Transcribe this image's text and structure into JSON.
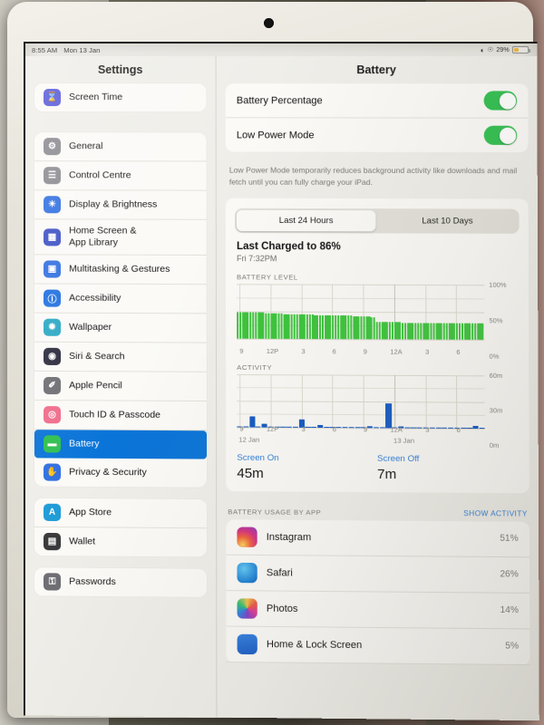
{
  "statusbar": {
    "time": "8:55 AM",
    "date": "Mon 13 Jan",
    "wifi_icon": "wifi-icon",
    "rotation_lock_icon": "rotation-lock-icon",
    "battery_percent": "29%",
    "battery_level": 29
  },
  "sidebar": {
    "title": "Settings",
    "groups": [
      {
        "items": [
          {
            "label": "Screen Time",
            "icon": "hourglass-icon",
            "color": "#5757d6",
            "selected": false
          }
        ]
      },
      {
        "items": [
          {
            "label": "General",
            "icon": "gear-icon",
            "color": "#8a8a8f",
            "selected": false
          },
          {
            "label": "Control Centre",
            "icon": "sliders-icon",
            "color": "#8a8a8f",
            "selected": false
          },
          {
            "label": "Display & Brightness",
            "icon": "brightness-icon",
            "color": "#2f6fe0",
            "selected": false
          },
          {
            "label": "Home Screen &\nApp Library",
            "icon": "app-grid-icon",
            "color": "#3b4fc4",
            "selected": false
          },
          {
            "label": "Multitasking & Gestures",
            "icon": "multitasking-icon",
            "color": "#2f6fe0",
            "selected": false
          },
          {
            "label": "Accessibility",
            "icon": "accessibility-icon",
            "color": "#1f6fe0",
            "selected": false
          },
          {
            "label": "Wallpaper",
            "icon": "wallpaper-icon",
            "color": "#2aa8c4",
            "selected": false
          },
          {
            "label": "Siri & Search",
            "icon": "siri-icon",
            "color": "#2b2b3d",
            "selected": false
          },
          {
            "label": "Apple Pencil",
            "icon": "pencil-icon",
            "color": "#6e6e73",
            "selected": false
          },
          {
            "label": "Touch ID & Passcode",
            "icon": "fingerprint-icon",
            "color": "#f06c8a",
            "selected": false
          },
          {
            "label": "Battery",
            "icon": "battery-icon",
            "color": "#2fbf4f",
            "selected": true
          },
          {
            "label": "Privacy & Security",
            "icon": "hand-icon",
            "color": "#2f6fe0",
            "selected": false
          }
        ]
      },
      {
        "items": [
          {
            "label": "App Store",
            "icon": "app-store-icon",
            "color": "#1e9bd7",
            "selected": false
          },
          {
            "label": "Wallet",
            "icon": "wallet-icon",
            "color": "#3a3a3c",
            "selected": false
          }
        ]
      },
      {
        "items": [
          {
            "label": "Passwords",
            "icon": "key-icon",
            "color": "#6e6e73",
            "selected": false
          }
        ]
      }
    ]
  },
  "detail": {
    "title": "Battery",
    "toggles": [
      {
        "label": "Battery Percentage",
        "on": true
      },
      {
        "label": "Low Power Mode",
        "on": true
      }
    ],
    "footnote": "Low Power Mode temporarily reduces background activity like downloads and mail fetch until you can fully charge your iPad.",
    "segmented": {
      "options": [
        "Last 24 Hours",
        "Last 10 Days"
      ],
      "selected_index": 0
    },
    "last_charged": {
      "title": "Last Charged to 86%",
      "subtitle": "Fri 7:32PM"
    },
    "battery_section_label": "BATTERY LEVEL",
    "activity_section_label": "ACTIVITY",
    "stats": [
      {
        "key": "Screen On",
        "value": "45m"
      },
      {
        "key": "Screen Off",
        "value": "7m"
      }
    ],
    "usage_header": {
      "left": "BATTERY USAGE BY APP",
      "right": "SHOW ACTIVITY"
    },
    "apps": [
      {
        "name": "Instagram",
        "percent": "51%",
        "icon": "instagram-icon"
      },
      {
        "name": "Safari",
        "percent": "26%",
        "icon": "safari-icon"
      },
      {
        "name": "Photos",
        "percent": "14%",
        "icon": "photos-icon"
      },
      {
        "name": "Home & Lock Screen",
        "percent": "5%",
        "icon": "home-lock-screen-icon"
      }
    ]
  },
  "chart_data": [
    {
      "type": "bar",
      "title": "BATTERY LEVEL",
      "ylabel": "",
      "xlabel": "",
      "ylim": [
        0,
        100
      ],
      "ytick_labels": [
        "100%",
        "50%",
        "0%"
      ],
      "ytick_values": [
        100,
        50,
        0
      ],
      "xtick_labels": [
        "9",
        "12P",
        "3",
        "6",
        "9",
        "12A",
        "3",
        "6"
      ],
      "bar_color": "#3ac43a",
      "grid": true,
      "values": [
        48,
        48,
        48,
        48,
        48,
        48,
        48,
        48,
        47,
        47,
        47,
        46,
        46,
        46,
        46,
        46,
        46,
        46,
        45,
        45,
        45,
        45,
        45,
        45,
        44,
        44,
        44,
        44,
        44,
        44,
        43,
        43,
        43,
        43,
        43,
        43,
        43,
        43,
        42,
        42,
        42,
        42,
        42,
        42,
        42,
        41,
        41,
        41,
        41,
        41,
        41,
        41,
        40,
        40,
        31,
        31,
        31,
        31,
        31,
        31,
        31,
        31,
        31,
        31,
        30,
        30,
        30,
        30,
        30,
        30,
        30,
        30,
        30,
        30,
        30,
        30,
        30,
        30,
        30,
        30,
        30,
        30,
        30,
        30,
        30,
        30,
        30,
        30,
        30,
        29,
        29,
        29,
        29,
        29,
        29,
        29
      ]
    },
    {
      "type": "bar",
      "title": "ACTIVITY",
      "ylabel": "",
      "xlabel": "",
      "ylim": [
        0,
        60
      ],
      "ytick_labels": [
        "60m",
        "30m",
        "0m"
      ],
      "ytick_values": [
        60,
        30,
        0
      ],
      "xtick_labels": [
        "9",
        "12P",
        "3",
        "6",
        "9",
        "12A",
        "3",
        "6"
      ],
      "date_labels": [
        "12 Jan",
        "13 Jan"
      ],
      "bar_color": "#1158c4",
      "grid": true,
      "values": [
        0,
        0,
        12,
        0,
        4,
        0,
        0,
        0,
        1,
        0,
        9,
        0,
        0,
        3,
        0,
        0,
        0,
        0,
        0,
        0,
        0,
        2,
        0,
        0,
        28,
        0,
        2,
        0,
        0,
        0,
        0,
        0,
        0,
        0,
        0,
        0,
        0,
        0,
        3,
        0
      ]
    }
  ]
}
